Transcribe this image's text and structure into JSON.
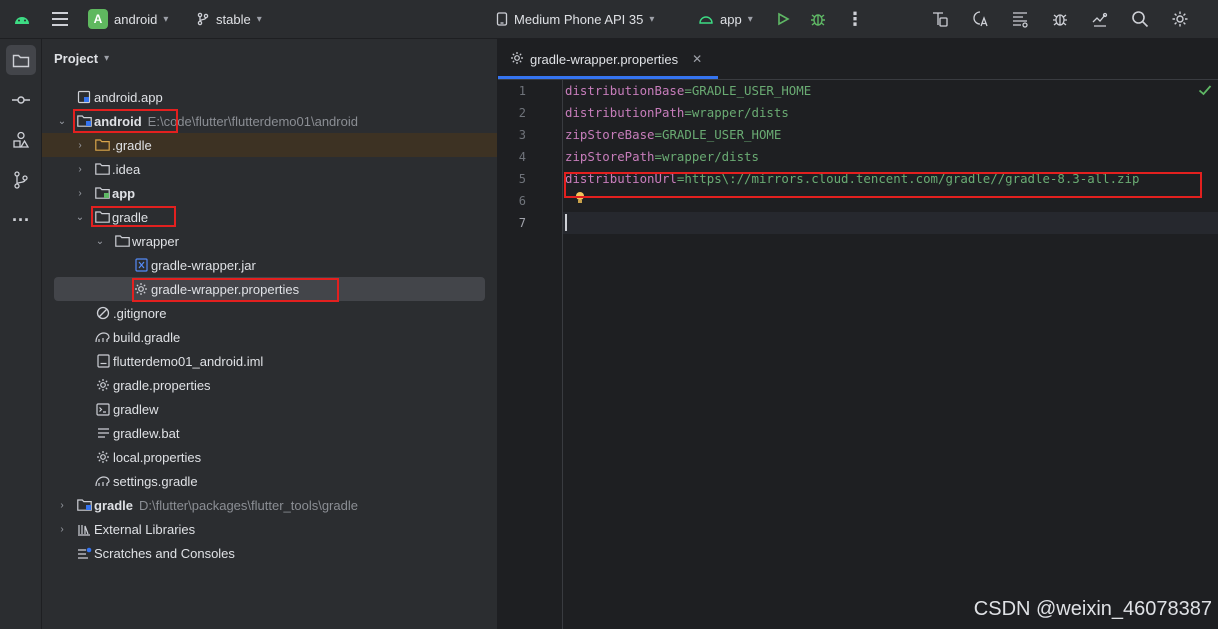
{
  "titlebar": {
    "project_badge": "A",
    "project_name": "android",
    "branch": "stable",
    "device": "Medium Phone API 35",
    "run_config": "app"
  },
  "project_panel": {
    "title": "Project",
    "tree": [
      {
        "label": "android.app",
        "icon": "module-icon"
      },
      {
        "label": "android",
        "path": "E:\\code\\flutter\\flutterdemo01\\android",
        "icon": "module-folder-icon",
        "bold": true
      },
      {
        "label": ".gradle",
        "icon": "folder-icon"
      },
      {
        "label": ".idea",
        "icon": "folder-icon"
      },
      {
        "label": "app",
        "icon": "module-folder-icon",
        "bold": true
      },
      {
        "label": "gradle",
        "icon": "folder-icon"
      },
      {
        "label": "wrapper",
        "icon": "folder-icon"
      },
      {
        "label": "gradle-wrapper.jar",
        "icon": "jar-icon"
      },
      {
        "label": "gradle-wrapper.properties",
        "icon": "gear-icon"
      },
      {
        "label": ".gitignore",
        "icon": "ignore-icon"
      },
      {
        "label": "build.gradle",
        "icon": "gradle-icon"
      },
      {
        "label": "flutterdemo01_android.iml",
        "icon": "file-icon"
      },
      {
        "label": "gradle.properties",
        "icon": "gear-icon"
      },
      {
        "label": "gradlew",
        "icon": "terminal-icon"
      },
      {
        "label": "gradlew.bat",
        "icon": "text-icon"
      },
      {
        "label": "local.properties",
        "icon": "gear-icon"
      },
      {
        "label": "settings.gradle",
        "icon": "gradle-icon"
      },
      {
        "label": "gradle",
        "path": "D:\\flutter\\packages\\flutter_tools\\gradle",
        "icon": "module-folder-icon",
        "bold": true
      },
      {
        "label": "External Libraries",
        "icon": "library-icon"
      },
      {
        "label": "Scratches and Consoles",
        "icon": "scratch-icon"
      }
    ]
  },
  "editor": {
    "tab_label": "gradle-wrapper.properties",
    "line_numbers": [
      "1",
      "2",
      "3",
      "4",
      "5",
      "6",
      "7"
    ],
    "lines": [
      {
        "key": "distributionBase",
        "value": "GRADLE_USER_HOME"
      },
      {
        "key": "distributionPath",
        "value": "wrapper/dists"
      },
      {
        "key": "zipStoreBase",
        "value": "GRADLE_USER_HOME"
      },
      {
        "key": "zipStorePath",
        "value": "wrapper/dists"
      },
      {
        "key": "distributionUrl",
        "value": "https\\://mirrors.cloud.tencent.com/gradle//gradle-8.3-all.zip"
      }
    ],
    "equals": "="
  },
  "watermark": "CSDN @weixin_46078387",
  "colors": {
    "accent": "#3574f0",
    "annotation_red": "#e3201f",
    "key_color": "#c77dbb",
    "value_color": "#6aab73"
  }
}
